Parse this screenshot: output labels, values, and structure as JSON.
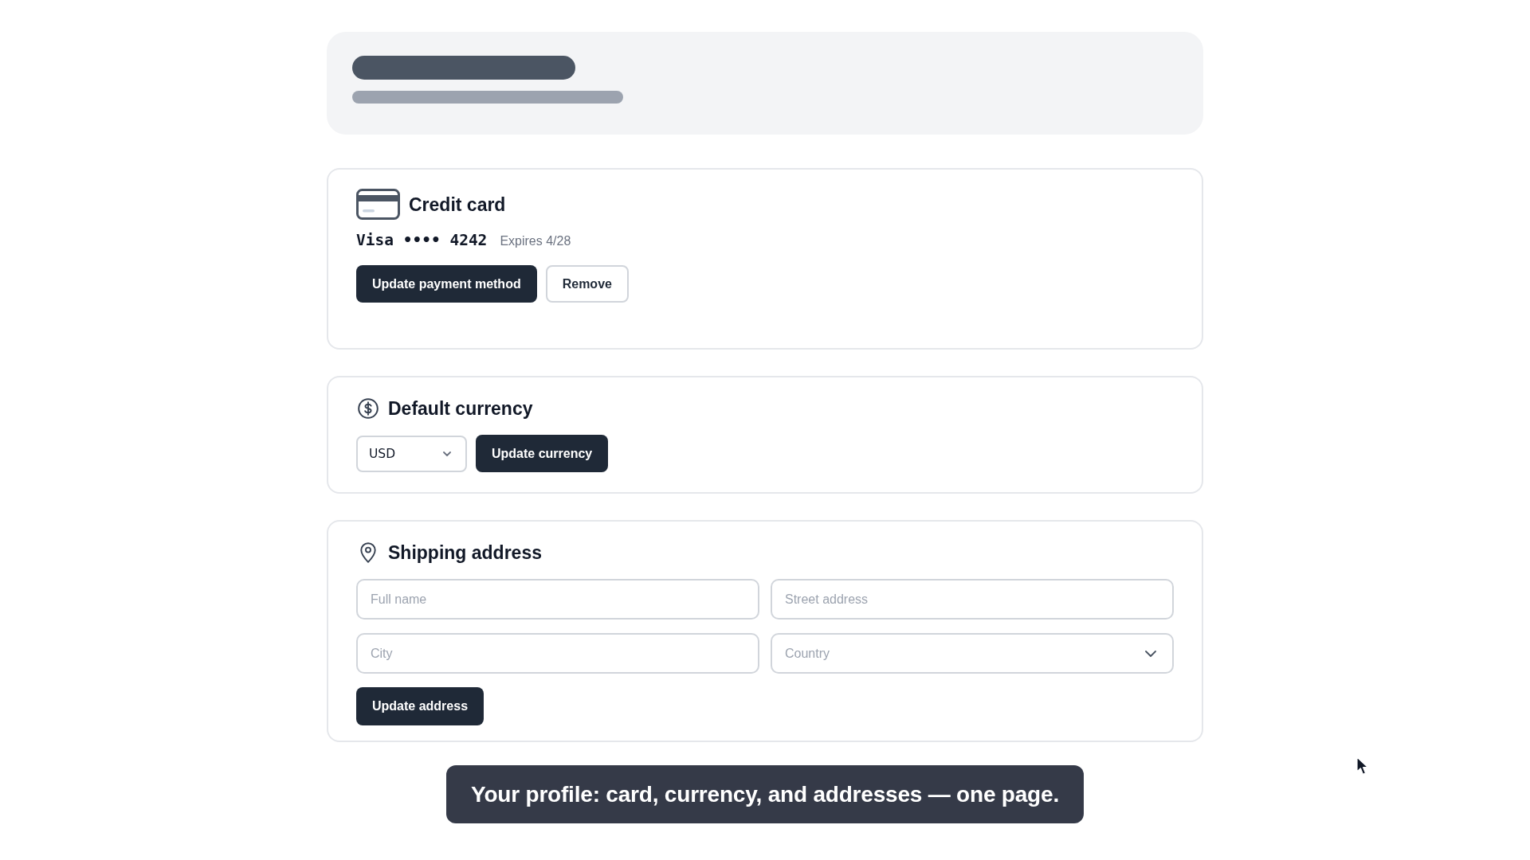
{
  "header": {
    "loading": true
  },
  "sections": [
    {
      "kind": "card",
      "title": "Credit card",
      "card_number": "Visa •••• 4242",
      "expiry": "Expires 4/28",
      "buttons": [
        {
          "label": "Update payment method",
          "kind": "primary"
        },
        {
          "label": "Remove",
          "kind": "secondary"
        }
      ]
    },
    {
      "kind": "currency",
      "title": "Default currency",
      "currency_select": {
        "value": "USD"
      },
      "buttons": [
        {
          "label": "Update currency",
          "kind": "primary"
        }
      ]
    },
    {
      "kind": "address",
      "title": "Shipping address",
      "fields": [
        {
          "kind": "text",
          "placeholder": "Full name"
        },
        {
          "kind": "text",
          "placeholder": "Street address"
        },
        {
          "kind": "text",
          "placeholder": "City"
        },
        {
          "kind": "select",
          "placeholder": "Country"
        }
      ],
      "buttons": [
        {
          "label": "Update address",
          "kind": "primary"
        }
      ]
    }
  ],
  "caption": {
    "text": "Your profile: card, currency, and addresses — one page."
  }
}
